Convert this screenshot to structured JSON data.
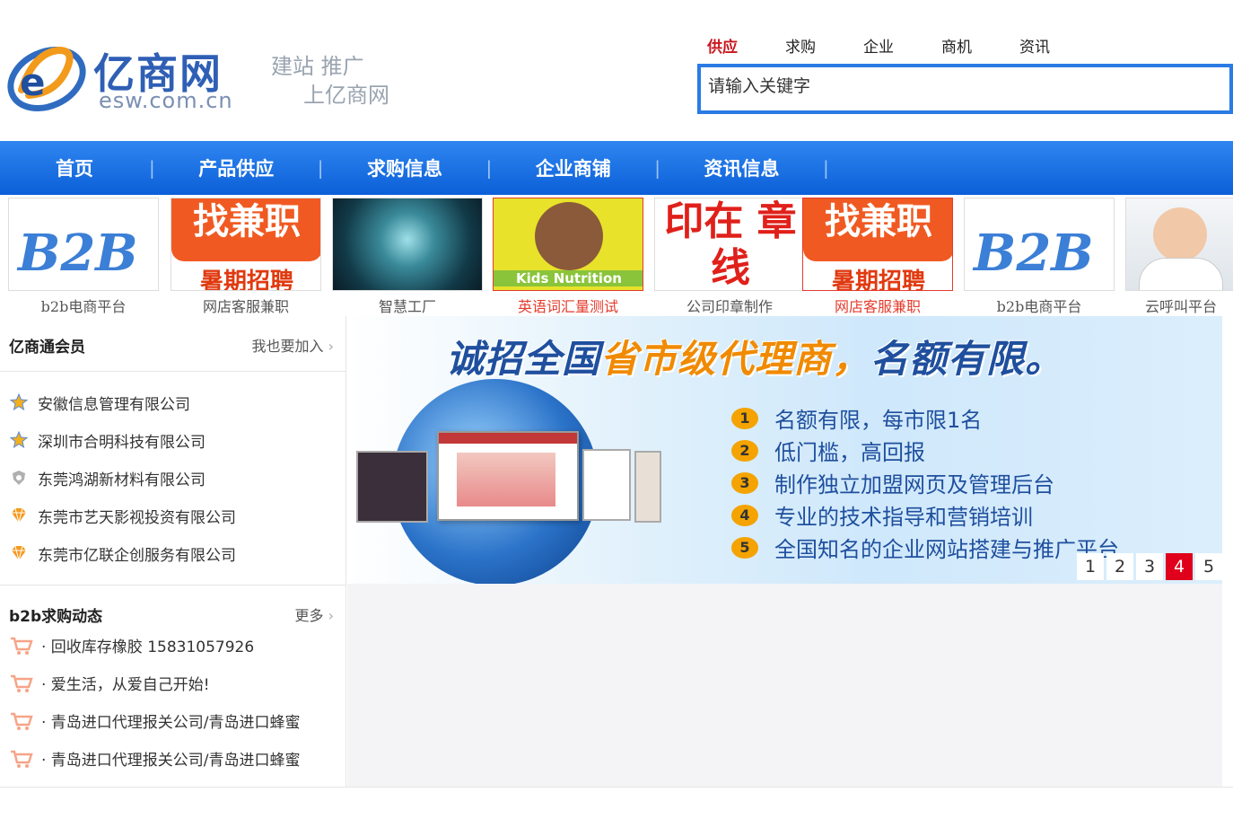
{
  "header": {
    "logo_text": "亿商网",
    "logo_domain": "esw.com.cn",
    "slogan_line1": "建站 推广",
    "slogan_line2": "上亿商网",
    "search_tabs": [
      "供应",
      "求购",
      "企业",
      "商机",
      "资讯"
    ],
    "search_placeholder": "请输入关键字"
  },
  "nav": {
    "items": [
      "首页",
      "产品供应",
      "求购信息",
      "企业商铺",
      "资讯信息"
    ]
  },
  "thumbs": [
    {
      "caption": "b2b电商平台",
      "img_text": "B2B",
      "red": false
    },
    {
      "caption": "网店客服兼职",
      "img_text": "找兼职",
      "img_sub": "暑期招聘",
      "red": false
    },
    {
      "caption": "智慧工厂",
      "img_text": "",
      "red": false
    },
    {
      "caption": "英语词汇量测试",
      "img_text": "Kids Nutrition",
      "red": true
    },
    {
      "caption": "公司印章制作",
      "img_text": "印在 章线",
      "red": false
    },
    {
      "caption": "网店客服兼职",
      "img_text": "找兼职",
      "img_sub": "暑期招聘",
      "red": true
    },
    {
      "caption": "b2b电商平台",
      "img_text": "B2B",
      "red": false
    },
    {
      "caption": "云呼叫平台",
      "img_text": "",
      "red": false
    }
  ],
  "members": {
    "title": "亿商通会员",
    "join_label": "我也要加入",
    "items": [
      {
        "name": "安徽信息管理有限公司",
        "icon": "gold-medal-icon"
      },
      {
        "name": "深圳市合明科技有限公司",
        "icon": "gold-medal-icon"
      },
      {
        "name": "东莞鸿湖新材料有限公司",
        "icon": "silver-shield-icon"
      },
      {
        "name": "东莞市艺天影视投资有限公司",
        "icon": "diamond-icon"
      },
      {
        "name": "东莞市亿联企创服务有限公司",
        "icon": "diamond-icon"
      }
    ]
  },
  "purchases": {
    "title": "b2b求购动态",
    "more_label": "更多",
    "items": [
      "· 回收库存橡胶 15831057926",
      "· 爱生活，从爱自己开始!",
      "· 青岛进口代理报关公司/青岛进口蜂蜜",
      "· 青岛进口代理报关公司/青岛进口蜂蜜"
    ]
  },
  "banner": {
    "title_a": "诚招全国",
    "title_b": "省市级代理商，",
    "title_c": "名额有限。",
    "bullets": [
      "名额有限，每市限1名",
      "低门槛，高回报",
      "制作独立加盟网页及管理后台",
      "专业的技术指导和营销培训",
      "全国知名的企业网站搭建与推广平台"
    ],
    "bullet_numbers": [
      "1",
      "2",
      "3",
      "4",
      "5"
    ],
    "pages": [
      "1",
      "2",
      "3",
      "4",
      "5"
    ],
    "active_page": "4"
  },
  "colors": {
    "brand_blue": "#0c5fd8",
    "accent_red": "#c8161d",
    "pager_active": "#e0001b"
  }
}
